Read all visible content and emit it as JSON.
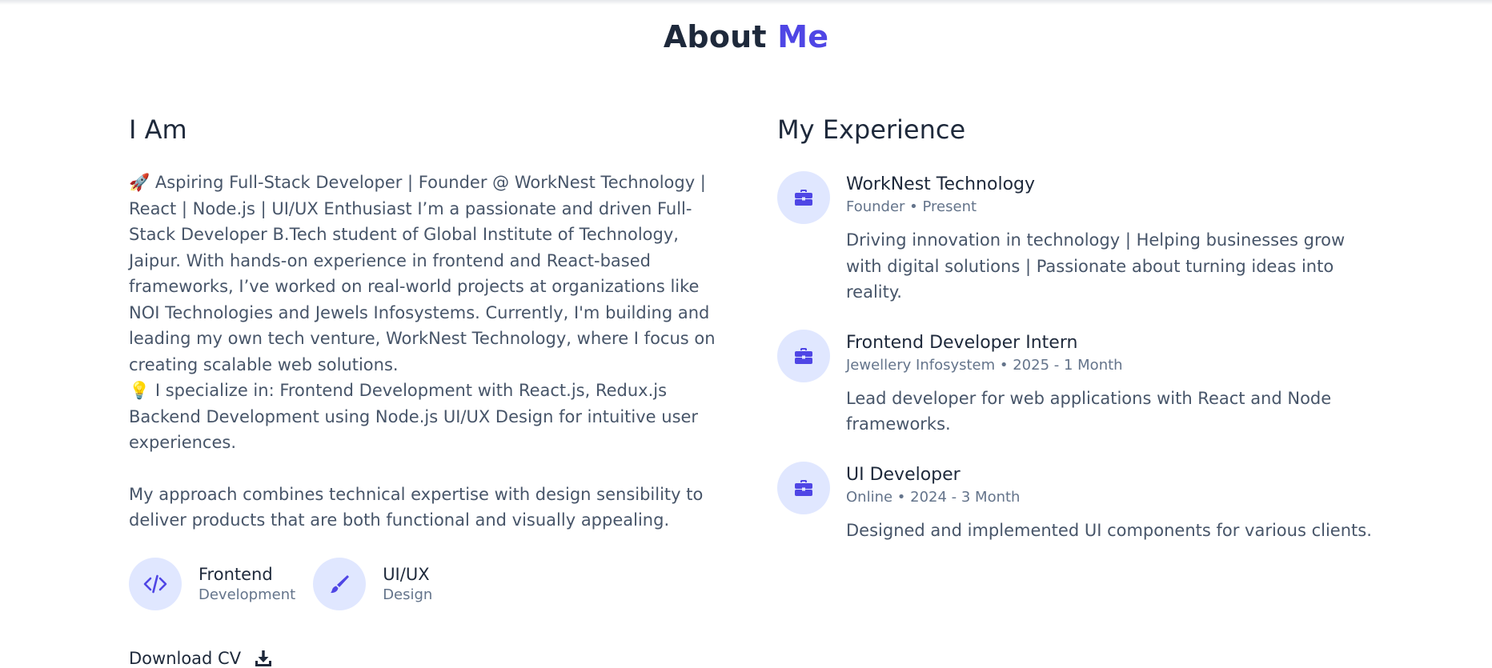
{
  "section": {
    "title_main": "About",
    "title_accent": "Me",
    "accent_color": "#4f46e5"
  },
  "about": {
    "heading": "I Am",
    "bio_paragraph_1": "🚀 Aspiring Full-Stack Developer | Founder @ WorkNest Technology | React | Node.js | UI/UX Enthusiast I’m a passionate and driven Full-Stack Developer B.Tech student of Global Institute of Technology, Jaipur. With hands-on experience in frontend and React-based frameworks, I’ve worked on real-world projects at organizations like NOI Technologies and Jewels Infosystems. Currently, I'm building and leading my own tech venture, WorkNest Technology, where I focus on creating scalable web solutions.",
    "bio_paragraph_2": "💡 I specialize in: Frontend Development with React.js, Redux.js Backend Development using Node.js UI/UX Design for intuitive user experiences.",
    "bio_paragraph_3": "My approach combines technical expertise with design sensibility to deliver products that are both functional and visually appealing.",
    "skills": [
      {
        "title": "Frontend",
        "subtitle": "Development",
        "icon": "code-icon"
      },
      {
        "title": "UI/UX",
        "subtitle": "Design",
        "icon": "paintbrush-icon"
      }
    ],
    "download_label": "Download CV",
    "download_icon": "download-icon"
  },
  "experience": {
    "heading": "My Experience",
    "items": [
      {
        "title": "WorkNest Technology",
        "meta": "Founder • Present",
        "description": "Driving innovation in technology | Helping businesses grow with digital solutions | Passionate about turning ideas into reality.",
        "icon": "briefcase-icon"
      },
      {
        "title": "Frontend Developer Intern",
        "meta": "Jewellery Infosystem • 2025 - 1 Month",
        "description": "Lead developer for web applications with React and Node frameworks.",
        "icon": "briefcase-icon"
      },
      {
        "title": "UI Developer",
        "meta": "Online • 2024 - 3 Month",
        "description": "Designed and implemented UI components for various clients.",
        "icon": "briefcase-icon"
      }
    ]
  }
}
